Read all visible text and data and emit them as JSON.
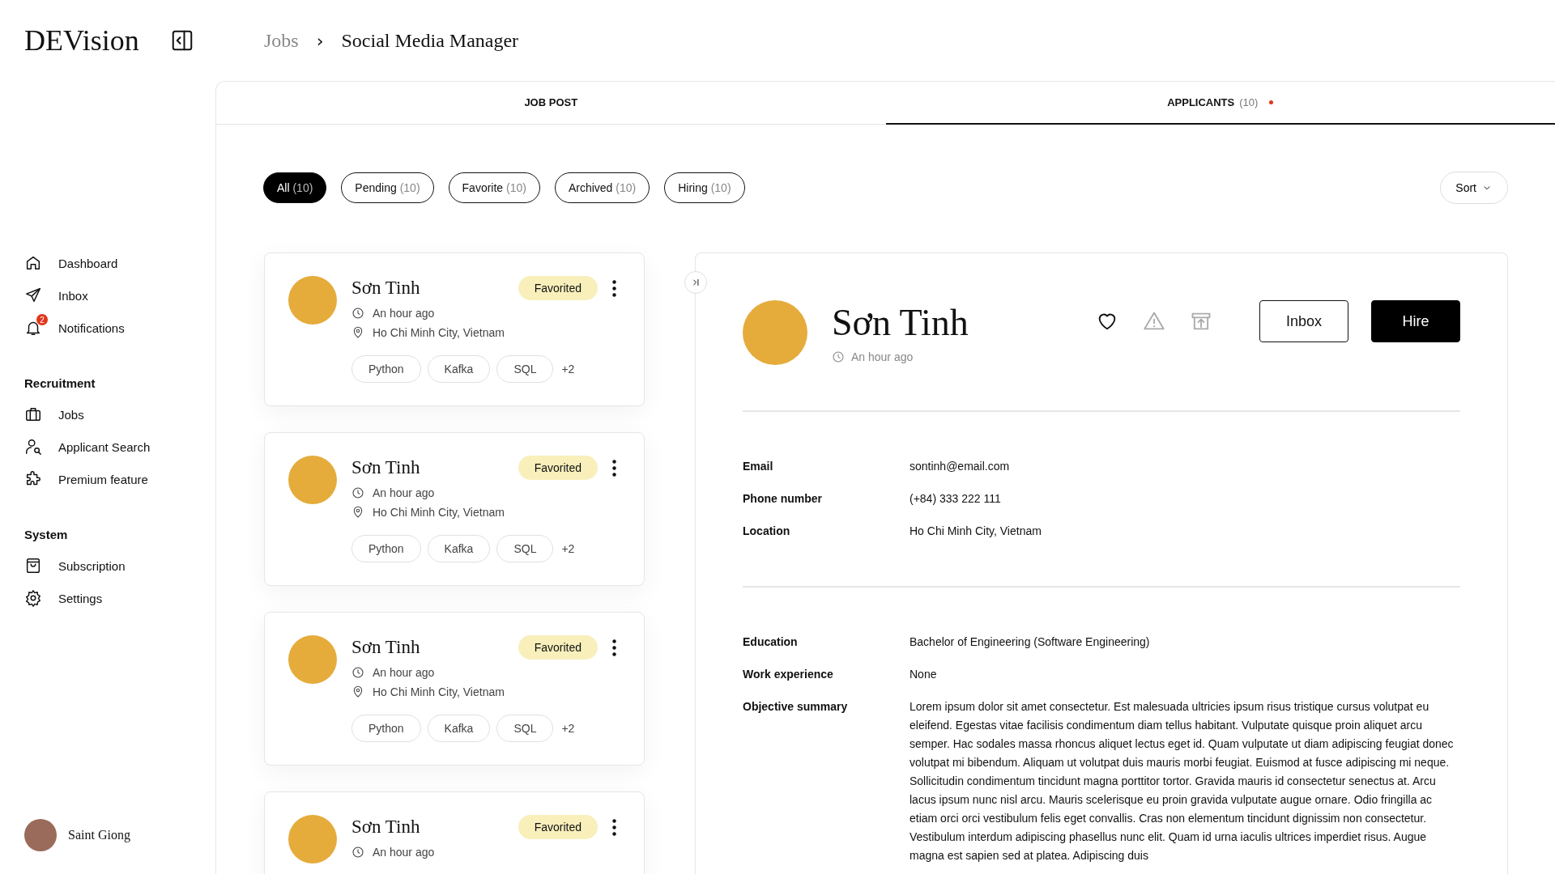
{
  "brand": {
    "logo": "DEVision"
  },
  "breadcrumb": {
    "parent": "Jobs",
    "separator": "›",
    "current": "Social Media Manager"
  },
  "sidebar": {
    "sections": [
      {
        "items": [
          {
            "kind": "home",
            "label": "Dashboard",
            "selected": false
          },
          {
            "kind": "send",
            "label": "Inbox",
            "selected": false
          },
          {
            "kind": "bell",
            "label": "Notifications",
            "badge": "2",
            "selected": false
          }
        ]
      },
      {
        "title": "Recruitment",
        "items": [
          {
            "kind": "briefcase",
            "label": "Jobs",
            "selected": false
          },
          {
            "kind": "usersearch",
            "label": "Applicant Search",
            "selected": false
          },
          {
            "kind": "puzzle",
            "label": "Premium feature",
            "selected": false
          }
        ]
      },
      {
        "title": "System",
        "items": [
          {
            "kind": "bag",
            "label": "Subscription",
            "selected": false
          },
          {
            "kind": "gear",
            "label": "Settings",
            "selected": false
          }
        ]
      }
    ],
    "user": {
      "name": "Saint Giong"
    }
  },
  "tabs": [
    {
      "label": "JOB POST",
      "selected": false,
      "alert": false
    },
    {
      "label": "APPLICANTS",
      "count": "(10)",
      "selected": true,
      "alert": true
    }
  ],
  "filters": [
    {
      "label": "All",
      "count": "(10)",
      "selected": true
    },
    {
      "label": "Pending",
      "count": "(10)",
      "selected": false
    },
    {
      "label": "Favorite",
      "count": "(10)",
      "selected": false
    },
    {
      "label": "Archived",
      "count": "(10)",
      "selected": false
    },
    {
      "label": "Hiring",
      "count": "(10)",
      "selected": false
    }
  ],
  "sort": {
    "label": "Sort"
  },
  "applicants": [
    {
      "name": "Sơn Tinh",
      "badge": "Favorited",
      "time": "An hour ago",
      "location": "Ho Chi Minh City, Vietnam",
      "tags": [
        "Python",
        "Kafka",
        "SQL"
      ],
      "more": "+2"
    },
    {
      "name": "Sơn Tinh",
      "badge": "Favorited",
      "time": "An hour ago",
      "location": "Ho Chi Minh City, Vietnam",
      "tags": [
        "Python",
        "Kafka",
        "SQL"
      ],
      "more": "+2"
    },
    {
      "name": "Sơn Tinh",
      "badge": "Favorited",
      "time": "An hour ago",
      "location": "Ho Chi Minh City, Vietnam",
      "tags": [
        "Python",
        "Kafka",
        "SQL"
      ],
      "more": "+2"
    },
    {
      "name": "Sơn Tinh",
      "badge": "Favorited",
      "time": "An hour ago"
    }
  ],
  "detail": {
    "name": "Sơn Tinh",
    "time": "An hour ago",
    "actions": [
      {
        "kind": "heart",
        "disabled": false
      },
      {
        "kind": "warning",
        "disabled": true
      },
      {
        "kind": "archive",
        "disabled": true
      }
    ],
    "buttons": [
      {
        "label": "Inbox",
        "kind": "outline"
      },
      {
        "label": "Hire",
        "kind": "primary"
      }
    ],
    "contact": [
      {
        "label": "Email",
        "value": "sontinh@email.com"
      },
      {
        "label": "Phone number",
        "value": "(+84) 333 222 111"
      },
      {
        "label": "Location",
        "value": "Ho Chi Minh City, Vietnam"
      }
    ],
    "profile": [
      {
        "label": "Education",
        "value": "Bachelor of Engineering (Software Engineering)"
      },
      {
        "label": "Work experience",
        "value": "None"
      },
      {
        "label": "Objective summary",
        "value": "Lorem ipsum dolor sit amet consectetur. Est malesuada ultricies ipsum risus tristique cursus volutpat eu eleifend. Egestas vitae facilisis condimentum diam tellus habitant. Vulputate quisque proin aliquet arcu semper. Hac sodales massa rhoncus aliquet lectus eget id. Quam vulputate ut diam adipiscing feugiat donec volutpat mi bibendum. Aliquam ut volutpat duis mauris morbi feugiat. Euismod at fusce adipiscing mi neque. Sollicitudin condimentum tincidunt magna porttitor tortor. Gravida mauris id consectetur senectus at. Arcu lacus ipsum nunc nisl arcu. Mauris scelerisque eu proin gravida vulputate augue ornare. Odio fringilla ac etiam orci orci vestibulum felis eget convallis. Cras non elementum tincidunt dignissim non consectetur. Vestibulum interdum adipiscing phasellus nunc elit. Quam id urna iaculis ultrices imperdiet risus. Augue magna est sapien sed at platea. Adipiscing duis"
      }
    ]
  }
}
